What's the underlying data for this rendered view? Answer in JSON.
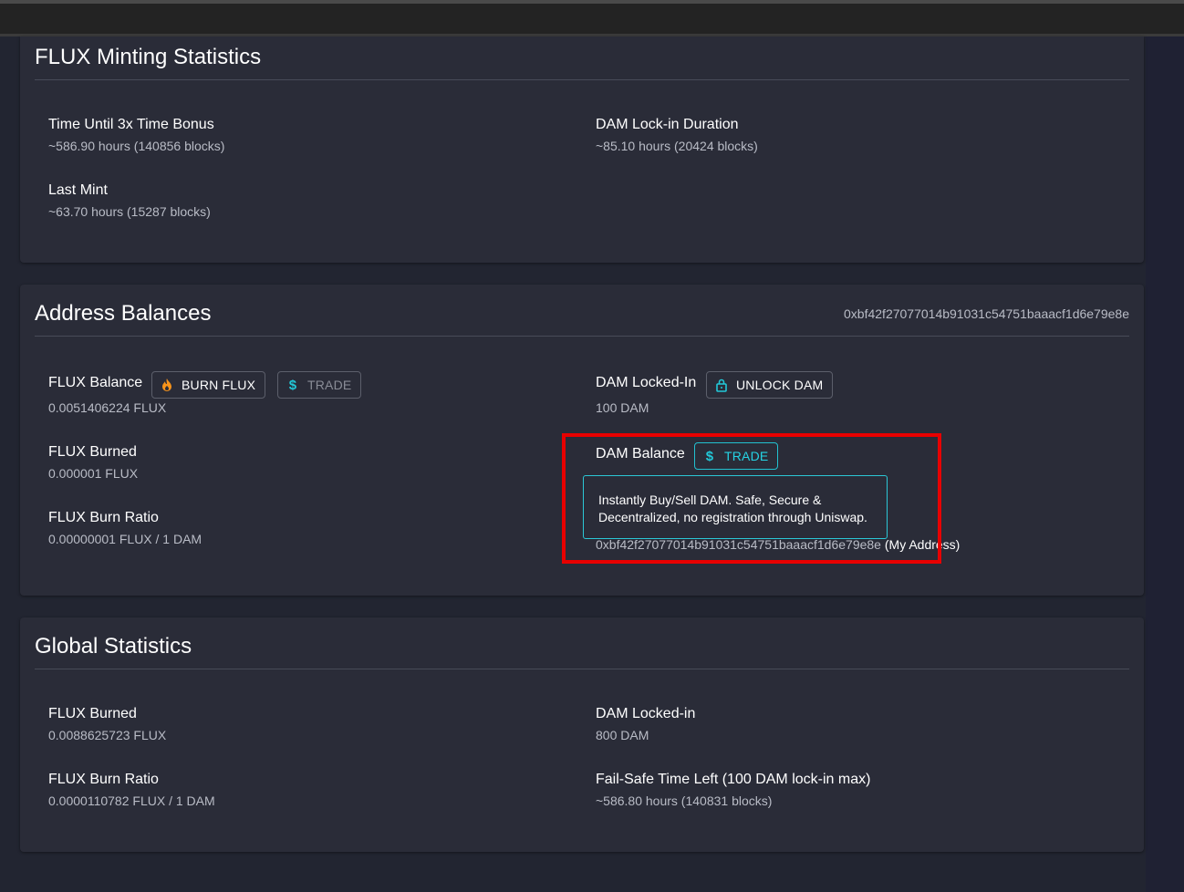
{
  "minting": {
    "title": "FLUX Minting Statistics",
    "time_bonus_label": "Time Until 3x Time Bonus",
    "time_bonus_value": "~586.90 hours (140856 blocks)",
    "lockin_duration_label": "DAM Lock-in Duration",
    "lockin_duration_value": "~85.10 hours (20424 blocks)",
    "last_mint_label": "Last Mint",
    "last_mint_value": "~63.70 hours (15287 blocks)"
  },
  "balances": {
    "title": "Address Balances",
    "address": "0xbf42f27077014b91031c54751baaacf1d6e79e8e",
    "flux_balance_label": "FLUX Balance",
    "burn_flux_button": "BURN FLUX",
    "trade_button": "TRADE",
    "flux_balance_value": "0.0051406224 FLUX",
    "dam_locked_label": "DAM Locked-In",
    "unlock_dam_button": "UNLOCK DAM",
    "dam_locked_value": "100 DAM",
    "flux_burned_label": "FLUX Burned",
    "flux_burned_value": "0.000001 FLUX",
    "dam_balance_label": "DAM Balance",
    "dam_trade_button": "TRADE",
    "flux_burn_ratio_label": "FLUX Burn Ratio",
    "flux_burn_ratio_value": "0.00000001 FLUX / 1 DAM",
    "mint_address": "0xbf42f27077014b91031c54751baaacf1d6e79e8e",
    "mint_address_suffix": "(My Address)"
  },
  "tooltip": {
    "line1": "Instantly Buy/Sell DAM. Safe, Secure &",
    "line2": "Decentralized, no registration through Uniswap."
  },
  "global": {
    "title": "Global Statistics",
    "flux_burned_label": "FLUX Burned",
    "flux_burned_value": "0.0088625723 FLUX",
    "dam_locked_label": "DAM Locked-in",
    "dam_locked_value": "800 DAM",
    "burn_ratio_label": "FLUX Burn Ratio",
    "burn_ratio_value": "0.0000110782 FLUX / 1 DAM",
    "failsafe_label": "Fail-Safe Time Left (100 DAM lock-in max)",
    "failsafe_value": "~586.80 hours (140831 blocks)"
  },
  "colors": {
    "background": "#222531",
    "card": "#2a2c38",
    "accent_teal": "#25d3e4",
    "highlight_red": "#e80000",
    "flame_orange": "#f7931a"
  },
  "icons": {
    "burn": "flame-icon",
    "trade": "dollar-icon",
    "unlock": "lock-icon"
  }
}
